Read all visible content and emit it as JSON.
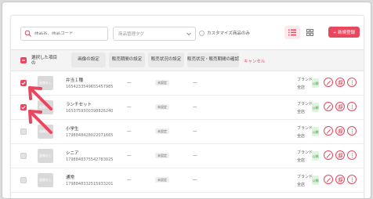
{
  "toolbar": {
    "search_placeholder": "商品名、商品コード",
    "tag_placeholder": "商品管理タグ",
    "custom_only_label": "カスタマイズ商品のみ",
    "new_button_label": "+ 新規登録"
  },
  "bulk": {
    "selected_label": "選択した項目の",
    "buttons": [
      "画像の設定",
      "販売期間の設定",
      "販売状況の設定",
      "販売状況・販売期間の確認"
    ],
    "cancel_label": "キャンセル"
  },
  "rows": [
    {
      "name": "弁当１種",
      "code": "1654233549655457985",
      "period": "—",
      "status": "未設定",
      "status2": "—",
      "brand": "ブランド",
      "store": "全店",
      "publish": "公開",
      "checked": true,
      "thumb": "画像なし"
    },
    {
      "name": "ランチセット",
      "code": "1653759300398826240",
      "period": "—",
      "status": "未設定",
      "status2": "—",
      "brand": "ブランド",
      "store": "全店",
      "publish": "公開",
      "checked": true,
      "thumb": "画像なし"
    },
    {
      "name": "小学生",
      "code": "1798848428022071665",
      "period": "—",
      "status": "未設定",
      "status2": "—",
      "brand": "ブランド",
      "store": "全店",
      "publish": "公開",
      "checked": false,
      "thumb": "画像なし"
    },
    {
      "name": "シニア",
      "code": "1798848375542783025",
      "period": "—",
      "status": "未設定",
      "status2": "—",
      "brand": "ブランド",
      "store": "全店",
      "publish": "公開",
      "checked": false,
      "thumb": "画像なし"
    },
    {
      "name": "通常",
      "code": "1798848332515933201",
      "period": "—",
      "status": "未設定",
      "status2": "—",
      "brand": "ブランド",
      "store": "全店",
      "publish": "公開",
      "checked": false,
      "thumb": "画像なし"
    }
  ],
  "colors": {
    "accent": "#e8475e",
    "publish_bg": "#dff3df",
    "publish_text": "#3a9a3a"
  }
}
